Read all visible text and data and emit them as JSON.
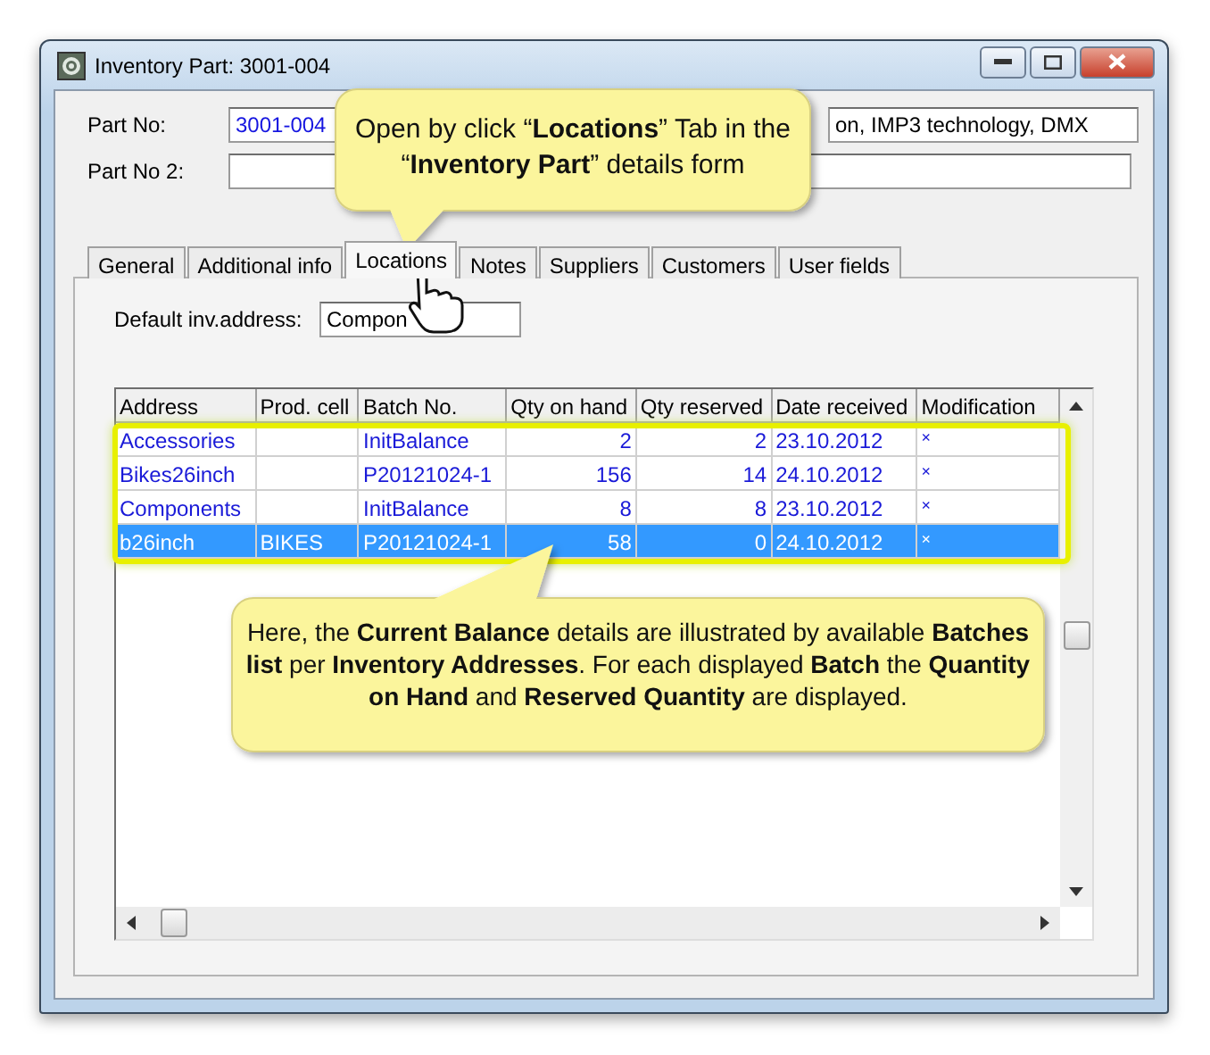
{
  "window": {
    "title": "Inventory Part: 3001-004"
  },
  "part_no": {
    "label": "Part No:",
    "value": "3001-004",
    "description": "on, IMP3 technology, DMX"
  },
  "part_no_2": {
    "label": "Part No 2:"
  },
  "tabs": [
    {
      "label": "General",
      "selected": false
    },
    {
      "label": "Additional info",
      "selected": false
    },
    {
      "label": "Locations",
      "selected": true
    },
    {
      "label": "Notes",
      "selected": false
    },
    {
      "label": "Suppliers",
      "selected": false
    },
    {
      "label": "Customers",
      "selected": false
    },
    {
      "label": "User fields",
      "selected": false
    }
  ],
  "default_address": {
    "label": "Default inv.address:",
    "value": "Compon"
  },
  "table": {
    "columns": [
      "Address",
      "Prod. cell",
      "Batch No.",
      "Qty on hand",
      "Qty reserved",
      "Date received",
      "Modification"
    ],
    "rows": [
      {
        "cells": [
          "Accessories",
          "",
          "InitBalance",
          "2",
          "2",
          "23.10.2012",
          "×"
        ],
        "selected": false
      },
      {
        "cells": [
          "Bikes26inch",
          "",
          "P20121024-1",
          "156",
          "14",
          "24.10.2012",
          "×"
        ],
        "selected": false
      },
      {
        "cells": [
          "Components",
          "",
          "InitBalance",
          "8",
          "8",
          "23.10.2012",
          "×"
        ],
        "selected": false
      },
      {
        "cells": [
          "b26inch",
          "BIKES",
          "P20121024-1",
          "58",
          "0",
          "24.10.2012",
          "×"
        ],
        "selected": true
      }
    ]
  },
  "callouts": [
    {
      "text": "Open by click “**Locations**” Tab in the “**Inventory Part**” details form"
    },
    {
      "text": "Here, the **Current Balance** details are illustrated by available **Batches list** per **Inventory Addresses**.  For each displayed **Batch** the **Quantity on Hand** and **Reserved Quantity** are displayed."
    }
  ]
}
